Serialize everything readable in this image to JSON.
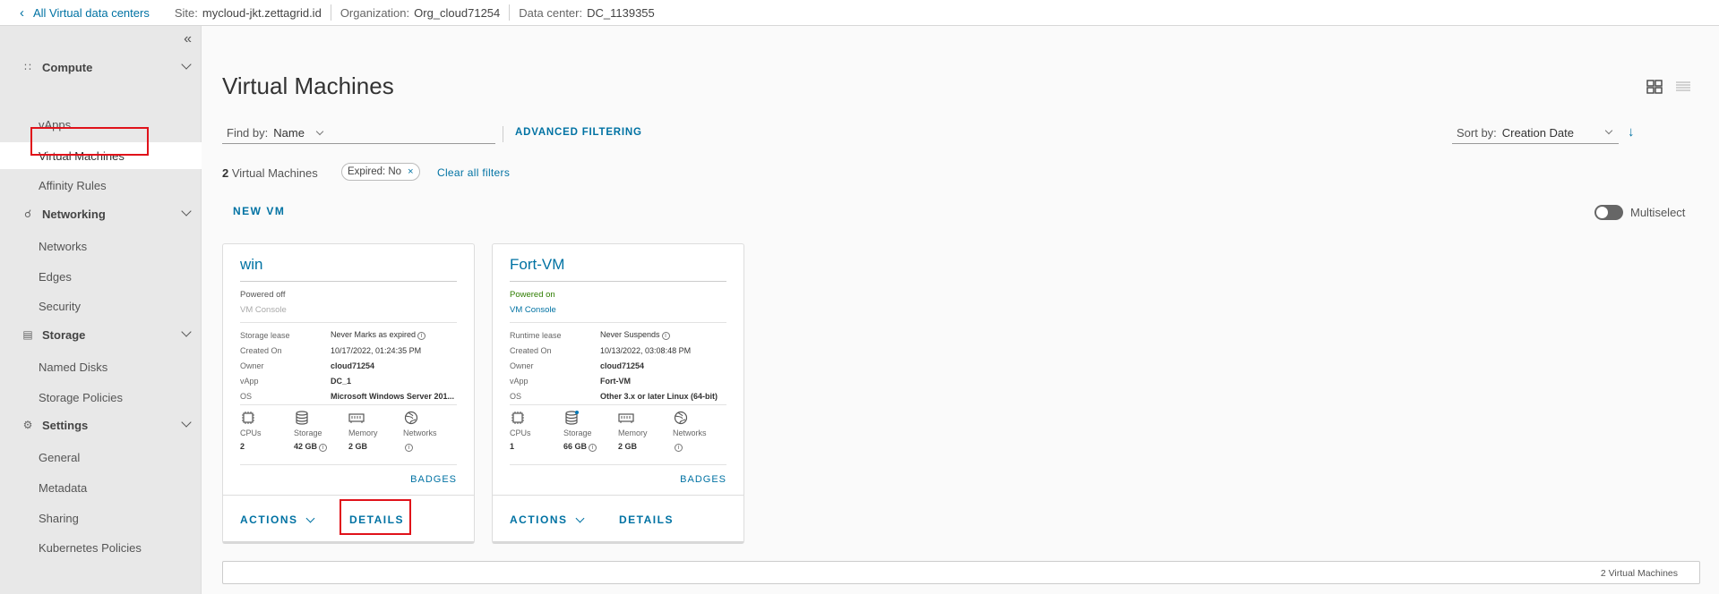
{
  "topbar": {
    "back_label": "All Virtual data centers",
    "site_key": "Site:",
    "site_value": "mycloud-jkt.zettagrid.id",
    "org_key": "Organization:",
    "org_value": "Org_cloud71254",
    "dc_key": "Data center:",
    "dc_value": "DC_1139355"
  },
  "sidebar": {
    "sections": {
      "compute": "Compute",
      "networking": "Networking",
      "storage": "Storage",
      "settings": "Settings"
    },
    "items": {
      "vapps": "vApps",
      "virtual_machines": "Virtual Machines",
      "affinity_rules": "Affinity Rules",
      "networks": "Networks",
      "edges": "Edges",
      "security": "Security",
      "named_disks": "Named Disks",
      "storage_policies": "Storage Policies",
      "general": "General",
      "metadata": "Metadata",
      "sharing": "Sharing",
      "kubernetes_policies": "Kubernetes Policies"
    },
    "active_item": "Virtual Machines"
  },
  "main": {
    "title": "Virtual Machines",
    "find_by_key": "Find by:",
    "find_by_value": "Name",
    "advanced_filtering": "ADVANCED FILTERING",
    "sort_by_key": "Sort by:",
    "sort_by_value": "Creation Date",
    "count_number": "2",
    "count_label": "Virtual Machines",
    "filter_chip": "Expired: No",
    "filter_chip_close": "×",
    "clear_filters": "Clear all filters",
    "new_vm": "NEW VM",
    "multiselect": "Multiselect",
    "footer_count": "2 Virtual Machines"
  },
  "vms": [
    {
      "name": "win",
      "status": "Powered off",
      "console": "VM Console",
      "lease_key": "Storage lease",
      "lease_value": "Never Marks as expired",
      "created_key": "Created On",
      "created_value": "10/17/2022, 01:24:35 PM",
      "owner_key": "Owner",
      "owner_value": "cloud71254",
      "vapp_key": "vApp",
      "vapp_value": "DC_1",
      "os_key": "OS",
      "os_value": "Microsoft Windows Server 201...",
      "cpus_label": "CPUs",
      "cpus_value": "2",
      "storage_label": "Storage",
      "storage_value": "42 GB",
      "memory_label": "Memory",
      "memory_value": "2 GB",
      "networks_label": "Networks",
      "badges": "BADGES",
      "actions": "ACTIONS",
      "details": "DETAILS"
    },
    {
      "name": "Fort-VM",
      "status": "Powered on",
      "console": "VM Console",
      "lease_key": "Runtime lease",
      "lease_value": "Never Suspends",
      "created_key": "Created On",
      "created_value": "10/13/2022, 03:08:48 PM",
      "owner_key": "Owner",
      "owner_value": "cloud71254",
      "vapp_key": "vApp",
      "vapp_value": "Fort-VM",
      "os_key": "OS",
      "os_value": "Other 3.x or later Linux (64-bit)",
      "cpus_label": "CPUs",
      "cpus_value": "1",
      "storage_label": "Storage",
      "storage_value": "66 GB",
      "memory_label": "Memory",
      "memory_value": "2 GB",
      "networks_label": "Networks",
      "badges": "BADGES",
      "actions": "ACTIONS",
      "details": "DETAILS"
    }
  ],
  "colors": {
    "link": "#0072a3",
    "highlight_box": "#e0121a",
    "powered_on": "#2e7d00"
  }
}
